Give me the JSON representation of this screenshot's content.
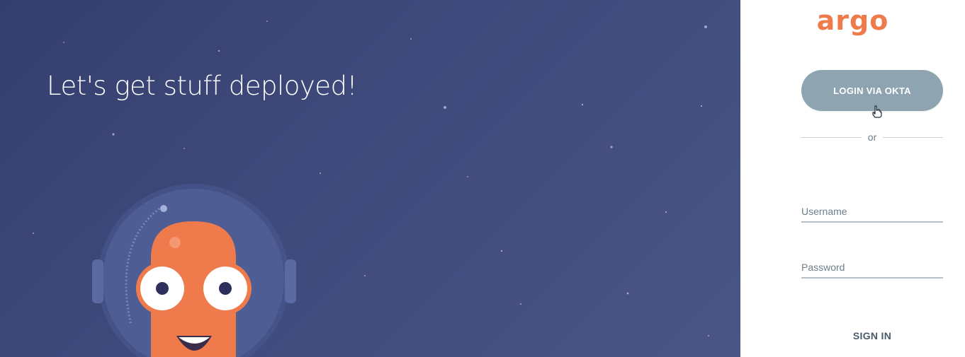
{
  "hero": {
    "title": "Let's get stuff deployed!",
    "background_color": "#3f4a7c",
    "mascot_icon": "argo-octopus-astronaut"
  },
  "login": {
    "logo_text": "argo",
    "logo_color": "#ef7b4d",
    "sso_button_label": "LOGIN VIA OKTA",
    "sso_button_color": "#8fa4b1",
    "divider_text": "or",
    "username_placeholder": "Username",
    "password_placeholder": "Password",
    "sign_in_label": "SIGN IN",
    "cursor_icon": "hand-pointer-icon"
  }
}
